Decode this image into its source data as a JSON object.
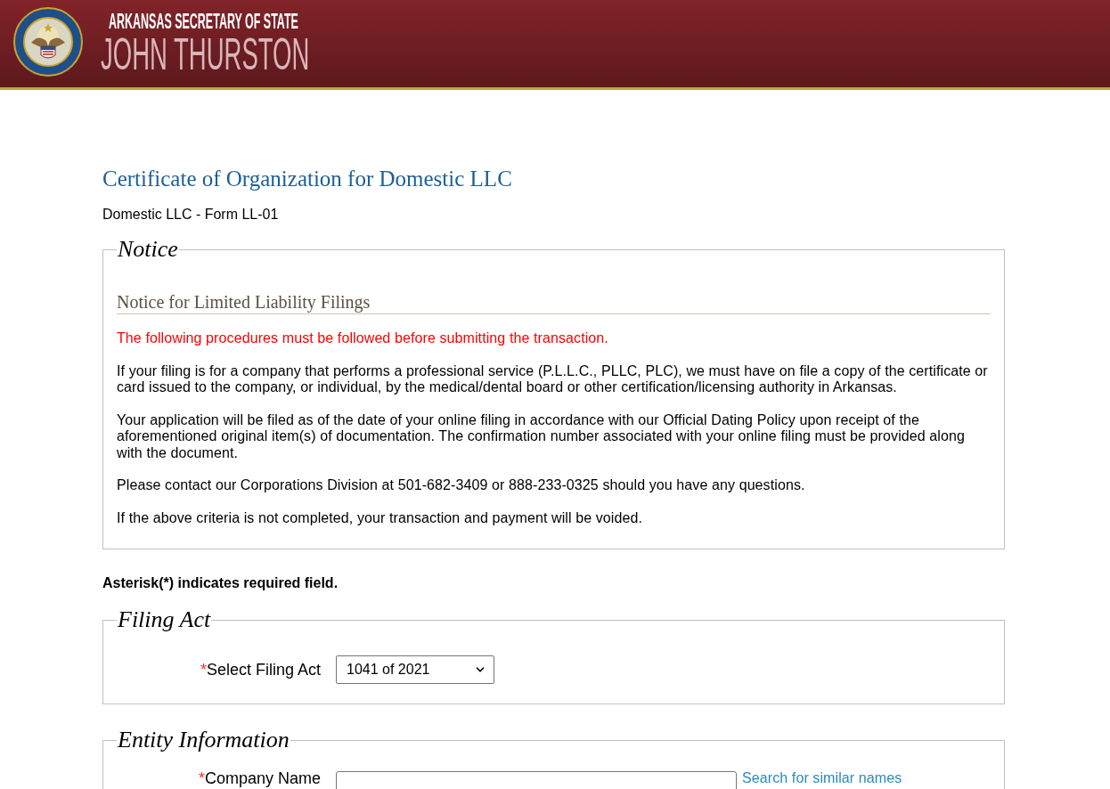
{
  "header": {
    "agency": "ARKANSAS SECRETARY OF STATE",
    "official": "JOHN THURSTON"
  },
  "page_title": "Certificate of Organization for Domestic LLC",
  "form_name": "Domestic LLC - Form LL-01",
  "notice": {
    "legend": "Notice",
    "heading": "Notice for Limited Liability Filings",
    "paragraphs": [
      {
        "kind": "warning",
        "text": "The following procedures must be followed before submitting the transaction."
      },
      {
        "kind": "body",
        "text": "If your filing is for a company that performs a professional service (P.L.L.C., PLLC, PLC), we must have on file a copy of the certificate or card issued to the company, or individual, by the medical/dental board or other certification/licensing authority in Arkansas."
      },
      {
        "kind": "body",
        "text": "Your application will be filed as of the date of your online filing in accordance with our Official Dating Policy upon receipt of the aforementioned original item(s) of documentation. The confirmation number associated with your online filing must be provided along with the document."
      },
      {
        "kind": "body",
        "text": "Please contact our Corporations Division at 501-682-3409 or 888-233-0325 should you have any questions."
      },
      {
        "kind": "body",
        "text": "If the above criteria is not completed, your transaction and payment will be voided."
      }
    ]
  },
  "required_note": "Asterisk(*) indicates required field.",
  "sections": [
    {
      "legend": "Filing Act",
      "fields": [
        {
          "kind": "select",
          "required_mark": "*",
          "label": "Select Filing Act",
          "value": "1041 of 2021"
        }
      ]
    },
    {
      "legend": "Entity Information",
      "fields": [
        {
          "kind": "text",
          "required_mark": "*",
          "label": "Company Name",
          "link": "Search for similar names"
        }
      ]
    }
  ]
}
